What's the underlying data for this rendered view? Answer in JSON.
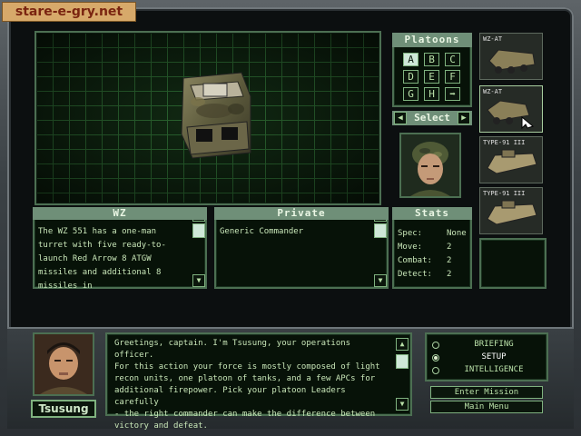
{
  "watermark": "stare-e-gry.net",
  "platoons": {
    "header": "Platoons",
    "buttons": [
      "A",
      "B",
      "C",
      "D",
      "E",
      "F",
      "G",
      "H"
    ],
    "active": "A",
    "arrow": "➡",
    "select_label": "Select",
    "prev_icon": "◀",
    "next_icon": "▶"
  },
  "units": [
    {
      "label": "WZ-AT",
      "selected": false
    },
    {
      "label": "WZ-AT",
      "selected": true
    },
    {
      "label": "TYPE-91 III",
      "selected": false
    },
    {
      "label": "TYPE-91 III",
      "selected": false
    }
  ],
  "unit_panel": {
    "header": "WZ",
    "text": "The WZ 551 has a one-man turret with five ready-to-launch Red Arrow 8 ATGW missiles and additional 8 missiles in"
  },
  "rank_panel": {
    "header": "Private",
    "text": "Generic Commander"
  },
  "stats": {
    "header": "Stats",
    "rows": [
      {
        "label": "Spec:",
        "value": "None"
      },
      {
        "label": "Move:",
        "value": "2"
      },
      {
        "label": "Combat:",
        "value": "2"
      },
      {
        "label": "Detect:",
        "value": "2"
      }
    ]
  },
  "scroll": {
    "up": "▲",
    "down": "▼"
  },
  "officer": {
    "name": "Tsusung",
    "briefing": "Greetings, captain.  I'm Tsusung, your operations officer.\nFor this action your force is mostly composed of light\nrecon units, one platoon of tanks, and a few APCs for\nadditional firepower.  Pick your platoon Leaders carefully\n- the right commander can make the difference between\nvictory and defeat."
  },
  "menu": {
    "items": [
      {
        "label": "BRIEFING",
        "selected": false
      },
      {
        "label": "SETUP",
        "selected": true
      },
      {
        "label": "INTELLIGENCE",
        "selected": false
      }
    ],
    "enter_mission": "Enter Mission",
    "main_menu": "Main Menu"
  }
}
